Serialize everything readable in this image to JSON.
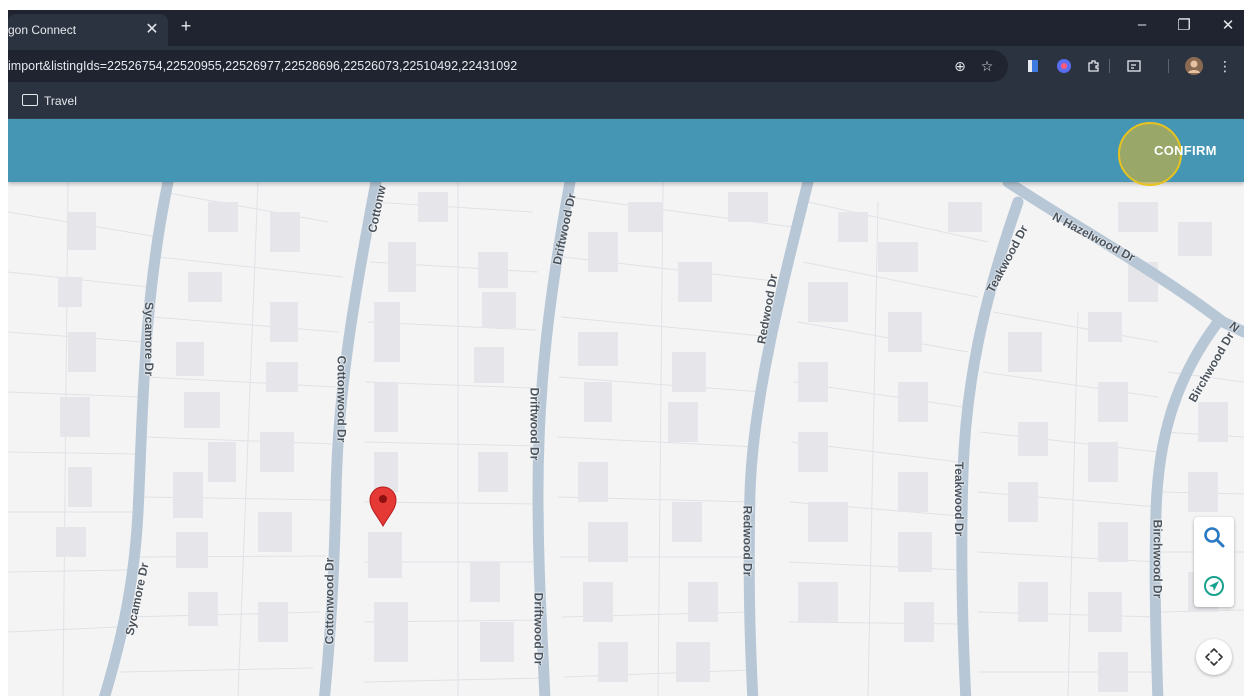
{
  "browser": {
    "tab_title": "gon Connect",
    "tab_close": "✕",
    "new_tab": "+",
    "url": "import&listingIds=22526754,22520955,22526977,22528696,22526073,22510492,22431092",
    "bookmark": "Travel"
  },
  "app": {
    "confirm_label": "CONFIRM"
  },
  "map": {
    "roads": [
      "Sycamore Dr",
      "Cottonw",
      "Cottonwood Dr",
      "Driftwood Dr",
      "Redwood Dr",
      "Teakwood Dr",
      "N Hazelwood Dr",
      "N",
      "Birchwood Dr"
    ]
  },
  "colors": {
    "app_bar": "#4596b4",
    "highlight": "#e8c21f",
    "road": "#b8c7d6",
    "pin": "#e53935",
    "control_blue": "#2b79c2",
    "control_green": "#1aa08e"
  },
  "icons": [
    "zoom-icon",
    "star-icon",
    "extension-icon",
    "profile-avatar",
    "search-icon",
    "navigate-icon",
    "recenter-icon",
    "map-pin-icon"
  ]
}
